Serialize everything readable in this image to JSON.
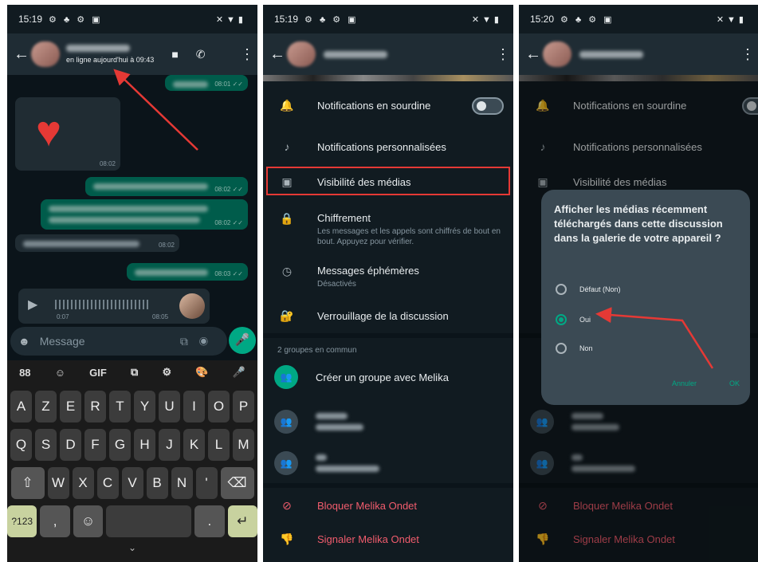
{
  "screen1": {
    "time": "15:19",
    "contact_status": "en ligne aujourd'hui à 09:43",
    "messages": [
      {
        "time": "08:01 ✓✓"
      },
      {
        "time": "08:02"
      },
      {
        "time": "08:02 ✓✓"
      },
      {
        "time": "08:02 ✓✓"
      },
      {
        "time": "08:02"
      },
      {
        "time": "08:03 ✓✓"
      }
    ],
    "voice": {
      "duration": "0:07",
      "time": "08:05"
    },
    "input_placeholder": "Message",
    "keyboard": {
      "top": [
        "88",
        "☺",
        "GIF",
        "⧉",
        "⚙",
        "🎨",
        "🎤"
      ],
      "row1": [
        "A",
        "Z",
        "E",
        "R",
        "T",
        "Y",
        "U",
        "I",
        "O",
        "P"
      ],
      "row2": [
        "Q",
        "S",
        "D",
        "F",
        "G",
        "H",
        "J",
        "K",
        "L",
        "M"
      ],
      "row3": [
        "W",
        "X",
        "C",
        "V",
        "B",
        "N",
        "'"
      ],
      "sym": "?123",
      "comma": ",",
      "period": "."
    }
  },
  "screen2": {
    "time": "15:19",
    "rows": {
      "mute": "Notifications en sourdine",
      "custom": "Notifications personnalisées",
      "media": "Visibilité des médias",
      "enc": "Chiffrement",
      "enc_sub": "Les messages et les appels sont chiffrés de bout en bout. Appuyez pour vérifier.",
      "eph": "Messages éphémères",
      "eph_sub": "Désactivés",
      "lock": "Verrouillage de la discussion"
    },
    "groups_header": "2 groupes en commun",
    "create_group": "Créer un groupe avec Melika",
    "block": "Bloquer Melika Ondet",
    "report": "Signaler Melika Ondet"
  },
  "screen3": {
    "time": "15:20",
    "dialog_title": "Afficher les médias récemment téléchargés dans cette discussion dans la galerie de votre appareil ?",
    "options": [
      "Défaut (Non)",
      "Oui",
      "Non"
    ],
    "selected": "Oui",
    "cancel": "Annuler",
    "ok": "OK"
  },
  "colors": {
    "accent": "#00a884",
    "annotation": "#e53935",
    "danger": "#f15c6d"
  }
}
